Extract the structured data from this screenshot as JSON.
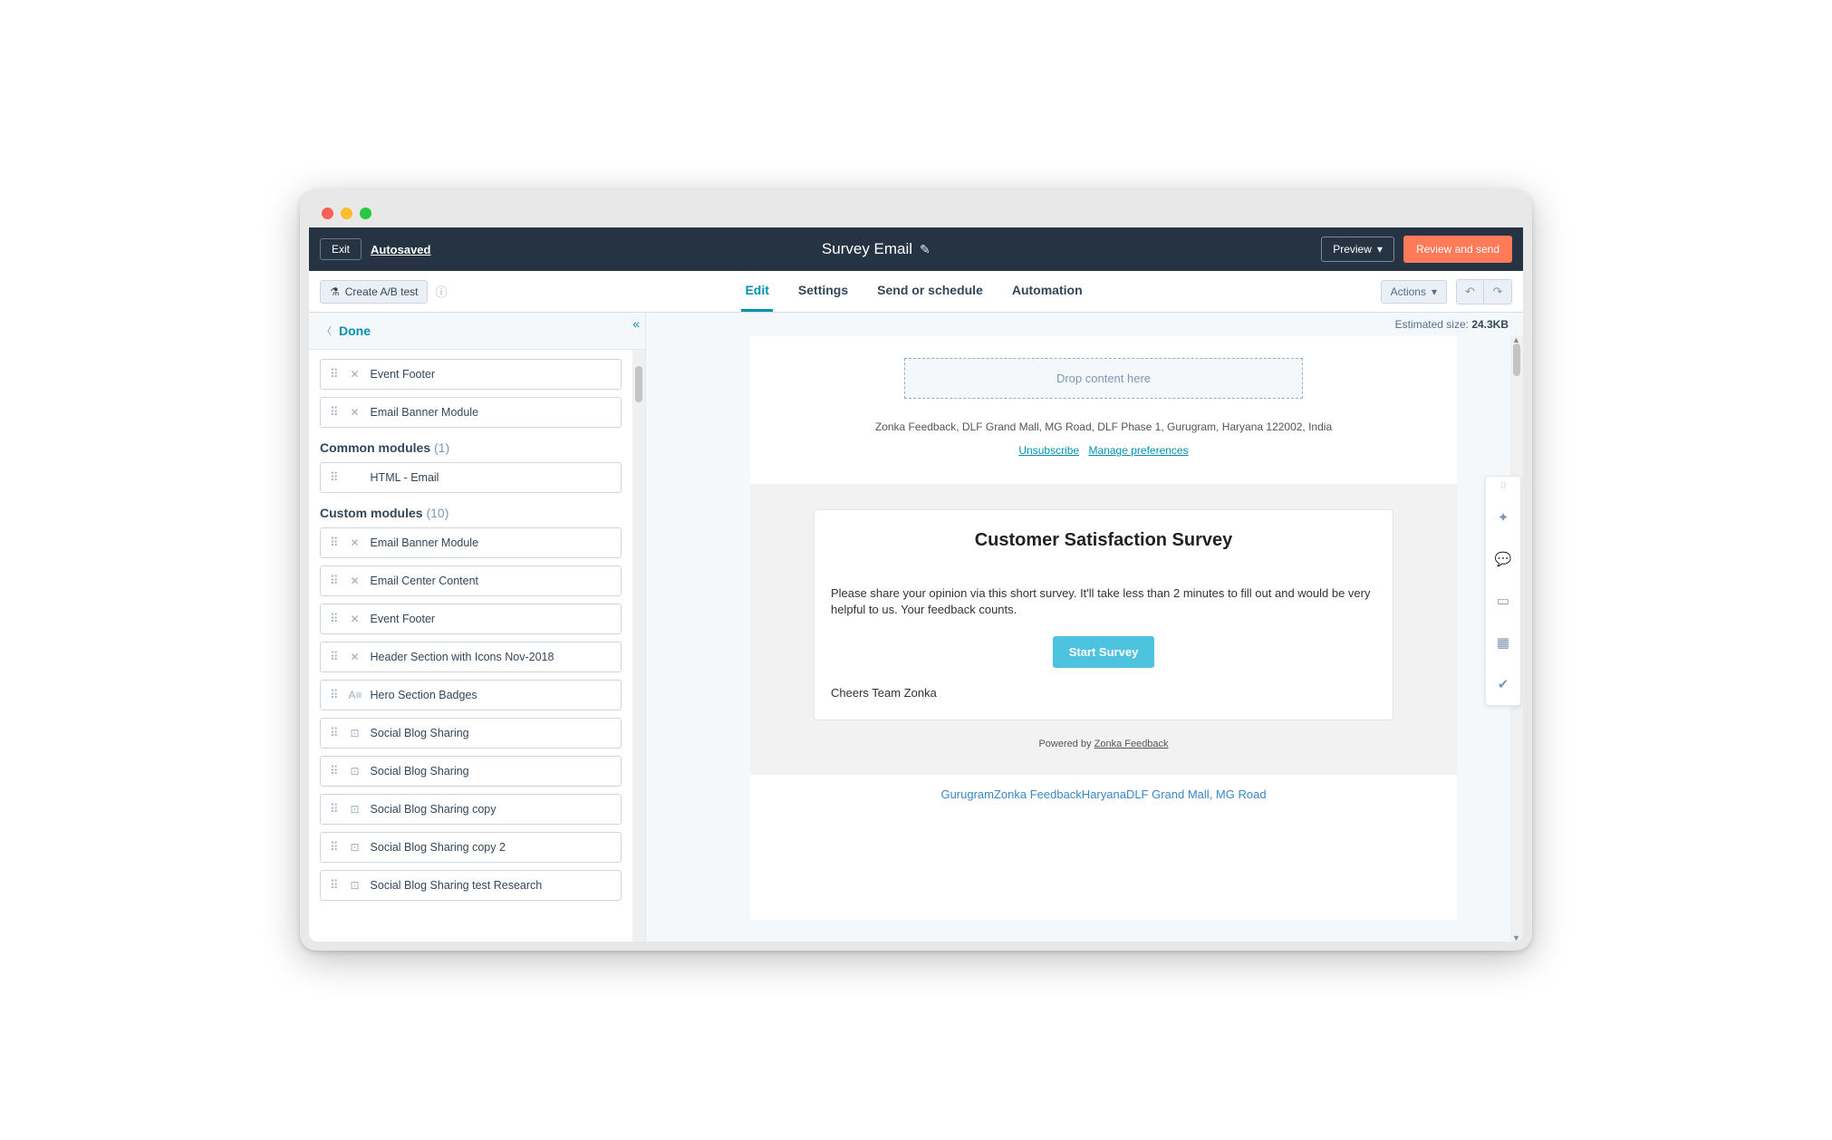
{
  "topbar": {
    "exit": "Exit",
    "autosaved": "Autosaved",
    "title": "Survey Email",
    "preview": "Preview",
    "review": "Review and send"
  },
  "toolbar": {
    "ab_test": "Create A/B test",
    "actions": "Actions",
    "tabs": [
      "Edit",
      "Settings",
      "Send or schedule",
      "Automation"
    ]
  },
  "sidebar": {
    "done": "Done",
    "top_modules": [
      {
        "icon": "✕",
        "label": "Event Footer"
      },
      {
        "icon": "✕",
        "label": "Email Banner Module"
      }
    ],
    "common_heading": "Common modules",
    "common_count": "(1)",
    "common_modules": [
      {
        "icon": "</>",
        "label": "HTML - Email"
      }
    ],
    "custom_heading": "Custom modules",
    "custom_count": "(10)",
    "custom_modules": [
      {
        "icon": "✕",
        "label": "Email Banner Module"
      },
      {
        "icon": "✕",
        "label": "Email Center Content"
      },
      {
        "icon": "✕",
        "label": "Event Footer"
      },
      {
        "icon": "✕",
        "label": "Header Section with Icons Nov-2018"
      },
      {
        "icon": "A≡",
        "label": "Hero Section Badges"
      },
      {
        "icon": "⊡",
        "label": "Social Blog Sharing"
      },
      {
        "icon": "⊡",
        "label": "Social Blog Sharing"
      },
      {
        "icon": "⊡",
        "label": "Social Blog Sharing copy"
      },
      {
        "icon": "⊡",
        "label": "Social Blog Sharing copy 2"
      },
      {
        "icon": "⊡",
        "label": "Social Blog Sharing test Research"
      }
    ]
  },
  "canvas": {
    "est_size_label": "Estimated size: ",
    "est_size_value": "24.3KB",
    "drop_text": "Drop content here",
    "footer_address": "Zonka Feedback, DLF Grand Mall, MG Road, DLF Phase 1, Gurugram, Haryana 122002, India",
    "unsubscribe": "Unsubscribe",
    "manage_prefs": "Manage preferences",
    "survey_title": "Customer Satisfaction Survey",
    "survey_body": "Please share your opinion via this short survey. It'll take less than 2 minutes to fill out and would be very helpful to us. Your feedback counts.",
    "start_survey": "Start Survey",
    "signoff": "Cheers Team Zonka",
    "powered_by_prefix": "Powered by ",
    "powered_by_link": "Zonka Feedback",
    "location_line": "GurugramZonka FeedbackHaryanaDLF Grand Mall, MG Road"
  }
}
